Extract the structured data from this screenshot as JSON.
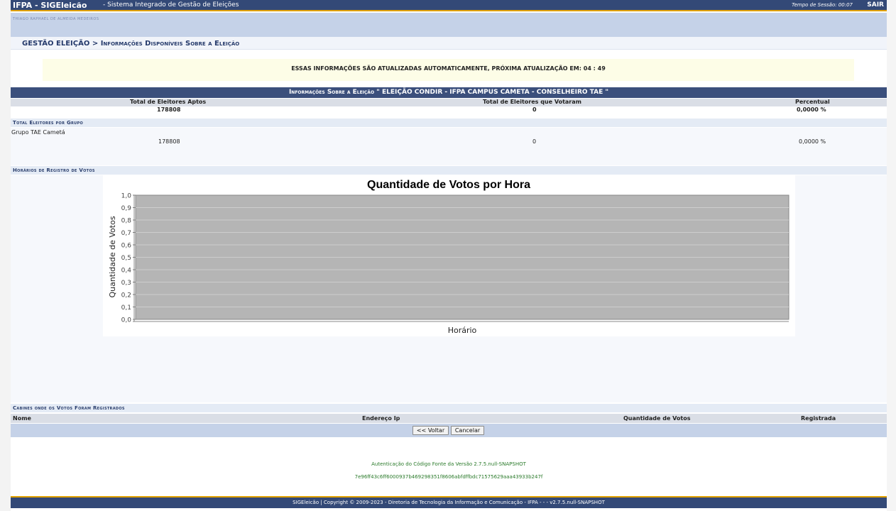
{
  "topbar": {
    "brand": "IFPA - SIGEleicão",
    "subtitle": "- Sistema Integrado de Gestão de Eleições",
    "session_label": "Tempo de Sessão: 00:07",
    "logout": "SAIR"
  },
  "user": {
    "name": "THIAGO RAPHAEL DE ALMEIDA MEDEIROS"
  },
  "breadcrumb": {
    "root": "GESTÃO ELEIÇÃO",
    "separator": ">",
    "current": "Informações Disponíveis Sobre a Eleição"
  },
  "notice": "ESSAS INFORMAÇÕES SÃO ATUALIZADAS AUTOMATICAMENTE, PRÓXIMA ATUALIZAÇÃO EM: 04 : 49",
  "info": {
    "title": "Informações Sobre a Eleição \" ELEIÇÃO CONDIR - IFPA CAMPUS CAMETA - CONSELHEIRO TAE \"",
    "columns": [
      "Total de Eleitores Aptos",
      "Total de Eleitores que Votaram",
      "Percentual"
    ],
    "totals": [
      "178808",
      "0",
      "0,0000 %"
    ]
  },
  "groups": {
    "section_title": "Total Eleitores por Grupo",
    "items": [
      {
        "name": "Grupo TAE Cametá",
        "aptos": "178808",
        "votaram": "0",
        "percentual": "0,0000 %"
      }
    ]
  },
  "times": {
    "section_title": "Horários de Registro de Votos"
  },
  "chart_data": {
    "type": "bar",
    "title": "Quantidade de Votos por Hora",
    "xlabel": "Horário",
    "ylabel": "Quantidade de Votos",
    "categories": [],
    "values": [],
    "ylim": [
      0,
      1.0
    ],
    "yticks": [
      "0,0",
      "0,1",
      "0,2",
      "0,3",
      "0,4",
      "0,5",
      "0,6",
      "0,7",
      "0,8",
      "0,9",
      "1,0"
    ],
    "grid": true,
    "plot_background": "#b5b5b5"
  },
  "cabins": {
    "section_title": "Cabines onde os Votos Foram Registrados",
    "columns": [
      "Nome",
      "Endereço Ip",
      "Quantidade de Votos",
      "Registrada"
    ]
  },
  "buttons": {
    "back": "<< Voltar",
    "cancel": "Cancelar"
  },
  "auth": {
    "line1": "Autenticação do Código Fonte da Versão 2.7.5.null-SNAPSHOT",
    "line2": "7e96ff43c6ff6000937b469298351f8606abfdffbdc71575629aaa43933b247f"
  },
  "footer": "SIGEleicão | Copyright © 2009-2023 - Diretoria de Tecnologia da Informação e Comunicação - IFPA - - - v2.7.5.null-SNAPSHOT",
  "colors": {
    "header": "#334977",
    "accent": "#e0a000",
    "section_text": "#2b3f6d"
  }
}
